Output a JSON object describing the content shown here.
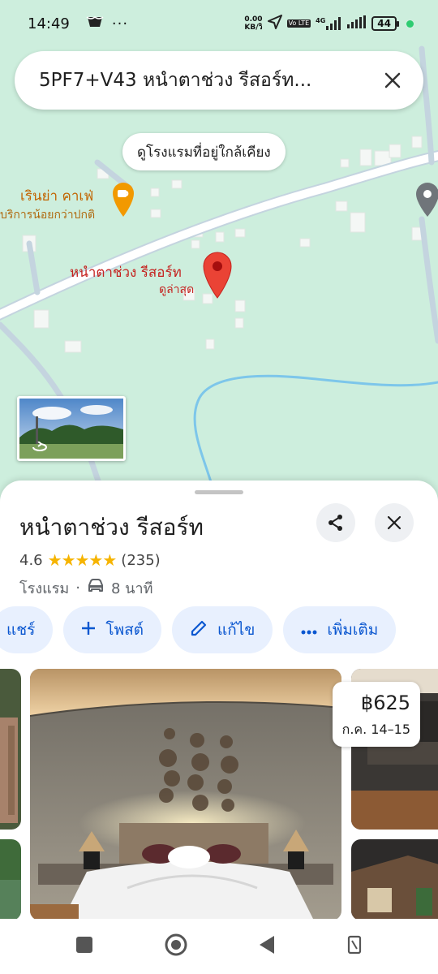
{
  "status_bar": {
    "time": "14:49",
    "net_speed_value": "0.00",
    "net_speed_unit": "KB/วิ",
    "signal_4g": "4G",
    "volte": "Vo LTE",
    "battery": "44"
  },
  "search": {
    "query": "5PF7+V43 หนำตาช่วง รีสอร์ท..."
  },
  "map": {
    "nearby_chip": "ดูโรงแรมที่อยู่ใกล้เคียง",
    "cafe_name": "เรินย่า คาเฟ่",
    "cafe_status": "บริการน้อยกว่าปกติ",
    "resort_label": "หนำตาช่วง รีสอร์ท",
    "resort_sub": "ดูล่าสุด"
  },
  "place": {
    "name": "หนำตาช่วง รีสอร์ท",
    "rating": "4.6",
    "stars": "★★★★★",
    "review_count": "(235)",
    "category": "โรงแรม",
    "separator": "·",
    "drive_time": "8 นาที"
  },
  "actions": {
    "share": "แชร์",
    "post": "โพสต์",
    "edit": "แก้ไข",
    "more": "เพิ่มเติม"
  },
  "price": {
    "amount": "฿625",
    "dates": "ก.ค. 14–15"
  },
  "colors": {
    "map_bg": "#cdeedd",
    "pin_red": "#ea4335",
    "cafe_orange": "#f29900",
    "action_blue": "#0b57d0",
    "pill_bg": "#e8f0fe",
    "star_gold": "#f6b400"
  }
}
